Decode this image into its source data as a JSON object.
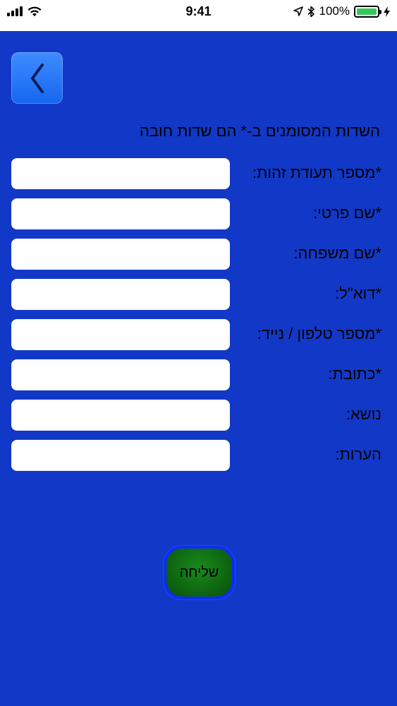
{
  "status_bar": {
    "time": "9:41",
    "battery_percent": "100%",
    "battery_color": "#35c759"
  },
  "header": {
    "back_icon": "chevron-left-icon",
    "required_note": "השדות המסומנים ב-* הם שדות חובה"
  },
  "form": {
    "fields": [
      {
        "label": "*מספר תעודת זהות:",
        "value": "",
        "placeholder": ""
      },
      {
        "label": "*שם פרטי:",
        "value": "",
        "placeholder": ""
      },
      {
        "label": "*שם משפחה:",
        "value": "",
        "placeholder": ""
      },
      {
        "label": "*דוא\"ל:",
        "value": "",
        "placeholder": ""
      },
      {
        "label": "*מספר טלפון / נייד:",
        "value": "",
        "placeholder": ""
      },
      {
        "label": "*כתובת:",
        "value": "",
        "placeholder": ""
      },
      {
        "label": "נושא:",
        "value": "",
        "placeholder": ""
      },
      {
        "label": "הערות:",
        "value": "",
        "placeholder": ""
      }
    ],
    "submit_label": "שליחה"
  },
  "colors": {
    "background": "#1238c7",
    "back_button": "#2a78ff",
    "submit_button": "#0f6a12"
  }
}
